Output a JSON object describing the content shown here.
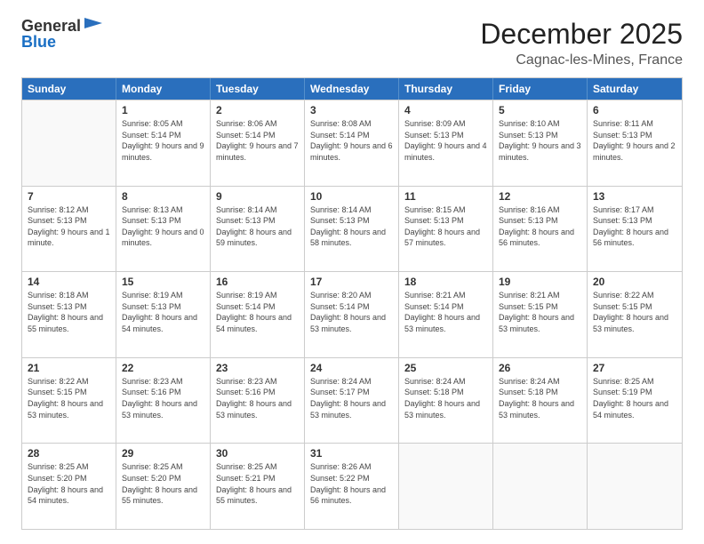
{
  "logo": {
    "general": "General",
    "blue": "Blue"
  },
  "title": "December 2025",
  "location": "Cagnac-les-Mines, France",
  "header_days": [
    "Sunday",
    "Monday",
    "Tuesday",
    "Wednesday",
    "Thursday",
    "Friday",
    "Saturday"
  ],
  "weeks": [
    [
      {
        "day": "",
        "sunrise": "",
        "sunset": "",
        "daylight": ""
      },
      {
        "day": "1",
        "sunrise": "Sunrise: 8:05 AM",
        "sunset": "Sunset: 5:14 PM",
        "daylight": "Daylight: 9 hours and 9 minutes."
      },
      {
        "day": "2",
        "sunrise": "Sunrise: 8:06 AM",
        "sunset": "Sunset: 5:14 PM",
        "daylight": "Daylight: 9 hours and 7 minutes."
      },
      {
        "day": "3",
        "sunrise": "Sunrise: 8:08 AM",
        "sunset": "Sunset: 5:14 PM",
        "daylight": "Daylight: 9 hours and 6 minutes."
      },
      {
        "day": "4",
        "sunrise": "Sunrise: 8:09 AM",
        "sunset": "Sunset: 5:13 PM",
        "daylight": "Daylight: 9 hours and 4 minutes."
      },
      {
        "day": "5",
        "sunrise": "Sunrise: 8:10 AM",
        "sunset": "Sunset: 5:13 PM",
        "daylight": "Daylight: 9 hours and 3 minutes."
      },
      {
        "day": "6",
        "sunrise": "Sunrise: 8:11 AM",
        "sunset": "Sunset: 5:13 PM",
        "daylight": "Daylight: 9 hours and 2 minutes."
      }
    ],
    [
      {
        "day": "7",
        "sunrise": "Sunrise: 8:12 AM",
        "sunset": "Sunset: 5:13 PM",
        "daylight": "Daylight: 9 hours and 1 minute."
      },
      {
        "day": "8",
        "sunrise": "Sunrise: 8:13 AM",
        "sunset": "Sunset: 5:13 PM",
        "daylight": "Daylight: 9 hours and 0 minutes."
      },
      {
        "day": "9",
        "sunrise": "Sunrise: 8:14 AM",
        "sunset": "Sunset: 5:13 PM",
        "daylight": "Daylight: 8 hours and 59 minutes."
      },
      {
        "day": "10",
        "sunrise": "Sunrise: 8:14 AM",
        "sunset": "Sunset: 5:13 PM",
        "daylight": "Daylight: 8 hours and 58 minutes."
      },
      {
        "day": "11",
        "sunrise": "Sunrise: 8:15 AM",
        "sunset": "Sunset: 5:13 PM",
        "daylight": "Daylight: 8 hours and 57 minutes."
      },
      {
        "day": "12",
        "sunrise": "Sunrise: 8:16 AM",
        "sunset": "Sunset: 5:13 PM",
        "daylight": "Daylight: 8 hours and 56 minutes."
      },
      {
        "day": "13",
        "sunrise": "Sunrise: 8:17 AM",
        "sunset": "Sunset: 5:13 PM",
        "daylight": "Daylight: 8 hours and 56 minutes."
      }
    ],
    [
      {
        "day": "14",
        "sunrise": "Sunrise: 8:18 AM",
        "sunset": "Sunset: 5:13 PM",
        "daylight": "Daylight: 8 hours and 55 minutes."
      },
      {
        "day": "15",
        "sunrise": "Sunrise: 8:19 AM",
        "sunset": "Sunset: 5:13 PM",
        "daylight": "Daylight: 8 hours and 54 minutes."
      },
      {
        "day": "16",
        "sunrise": "Sunrise: 8:19 AM",
        "sunset": "Sunset: 5:14 PM",
        "daylight": "Daylight: 8 hours and 54 minutes."
      },
      {
        "day": "17",
        "sunrise": "Sunrise: 8:20 AM",
        "sunset": "Sunset: 5:14 PM",
        "daylight": "Daylight: 8 hours and 53 minutes."
      },
      {
        "day": "18",
        "sunrise": "Sunrise: 8:21 AM",
        "sunset": "Sunset: 5:14 PM",
        "daylight": "Daylight: 8 hours and 53 minutes."
      },
      {
        "day": "19",
        "sunrise": "Sunrise: 8:21 AM",
        "sunset": "Sunset: 5:15 PM",
        "daylight": "Daylight: 8 hours and 53 minutes."
      },
      {
        "day": "20",
        "sunrise": "Sunrise: 8:22 AM",
        "sunset": "Sunset: 5:15 PM",
        "daylight": "Daylight: 8 hours and 53 minutes."
      }
    ],
    [
      {
        "day": "21",
        "sunrise": "Sunrise: 8:22 AM",
        "sunset": "Sunset: 5:15 PM",
        "daylight": "Daylight: 8 hours and 53 minutes."
      },
      {
        "day": "22",
        "sunrise": "Sunrise: 8:23 AM",
        "sunset": "Sunset: 5:16 PM",
        "daylight": "Daylight: 8 hours and 53 minutes."
      },
      {
        "day": "23",
        "sunrise": "Sunrise: 8:23 AM",
        "sunset": "Sunset: 5:16 PM",
        "daylight": "Daylight: 8 hours and 53 minutes."
      },
      {
        "day": "24",
        "sunrise": "Sunrise: 8:24 AM",
        "sunset": "Sunset: 5:17 PM",
        "daylight": "Daylight: 8 hours and 53 minutes."
      },
      {
        "day": "25",
        "sunrise": "Sunrise: 8:24 AM",
        "sunset": "Sunset: 5:18 PM",
        "daylight": "Daylight: 8 hours and 53 minutes."
      },
      {
        "day": "26",
        "sunrise": "Sunrise: 8:24 AM",
        "sunset": "Sunset: 5:18 PM",
        "daylight": "Daylight: 8 hours and 53 minutes."
      },
      {
        "day": "27",
        "sunrise": "Sunrise: 8:25 AM",
        "sunset": "Sunset: 5:19 PM",
        "daylight": "Daylight: 8 hours and 54 minutes."
      }
    ],
    [
      {
        "day": "28",
        "sunrise": "Sunrise: 8:25 AM",
        "sunset": "Sunset: 5:20 PM",
        "daylight": "Daylight: 8 hours and 54 minutes."
      },
      {
        "day": "29",
        "sunrise": "Sunrise: 8:25 AM",
        "sunset": "Sunset: 5:20 PM",
        "daylight": "Daylight: 8 hours and 55 minutes."
      },
      {
        "day": "30",
        "sunrise": "Sunrise: 8:25 AM",
        "sunset": "Sunset: 5:21 PM",
        "daylight": "Daylight: 8 hours and 55 minutes."
      },
      {
        "day": "31",
        "sunrise": "Sunrise: 8:26 AM",
        "sunset": "Sunset: 5:22 PM",
        "daylight": "Daylight: 8 hours and 56 minutes."
      },
      {
        "day": "",
        "sunrise": "",
        "sunset": "",
        "daylight": ""
      },
      {
        "day": "",
        "sunrise": "",
        "sunset": "",
        "daylight": ""
      },
      {
        "day": "",
        "sunrise": "",
        "sunset": "",
        "daylight": ""
      }
    ]
  ]
}
